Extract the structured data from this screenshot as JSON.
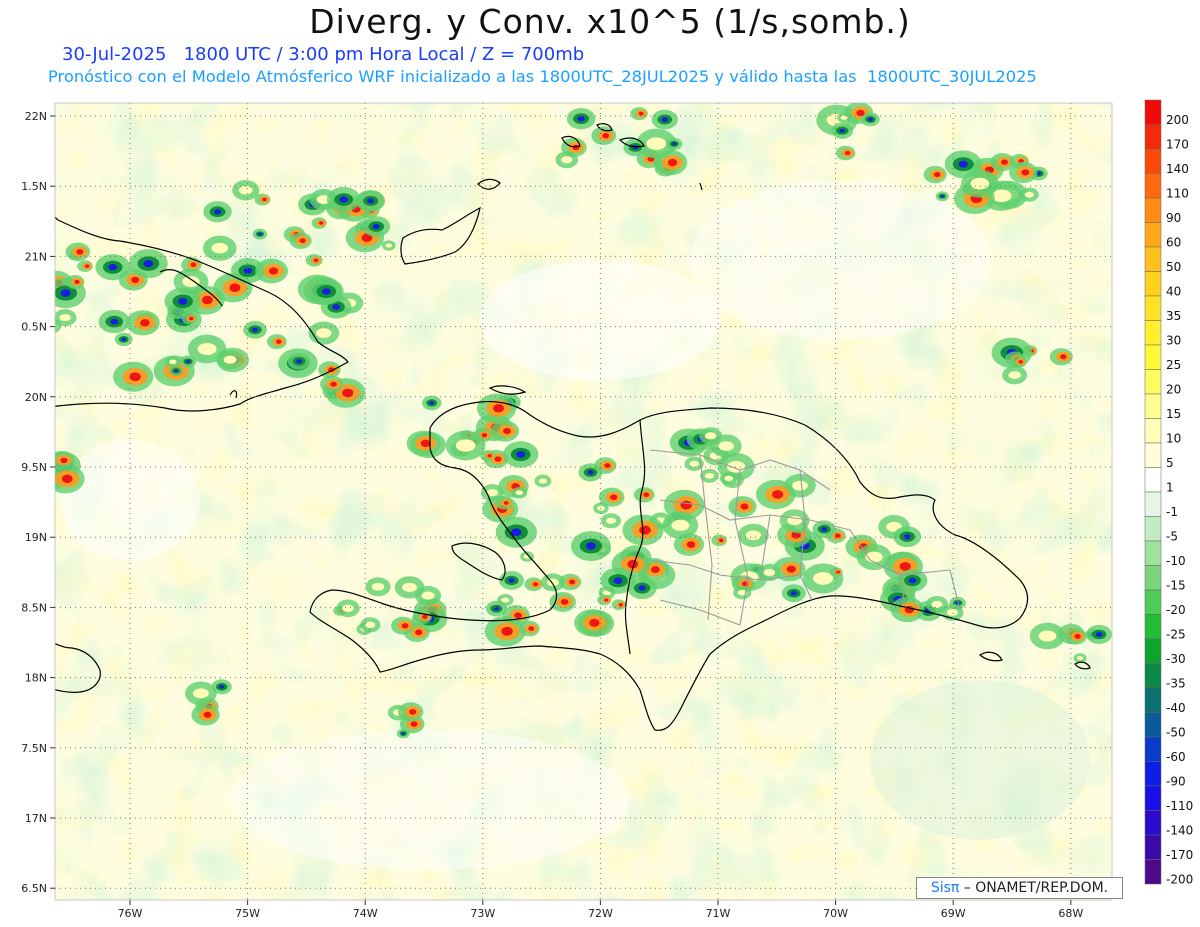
{
  "header": {
    "title": "Diverg. y Conv. x10^5 (1/s,somb.)",
    "subtitle_date": "30-Jul-2025   1800 UTC / 3:00 pm Hora Local / Z = 700mb",
    "subtitle_model": "Pronóstico con el Modelo Atmósferico WRF inicializado a las 1800UTC_28JUL2025 y válido hasta las  1800UTC_30JUL2025"
  },
  "map": {
    "lat_labels": [
      "22N",
      "1.5N",
      "21N",
      "0.5N",
      "20N",
      "9.5N",
      "19N",
      "8.5N",
      "18N",
      "7.5N",
      "17N",
      "6.5N"
    ],
    "lon_labels": [
      "76W",
      "75W",
      "74W",
      "73W",
      "72W",
      "71W",
      "70W",
      "69W",
      "68W"
    ],
    "lat_values": [
      22,
      21.5,
      21,
      20.5,
      20,
      19.5,
      19,
      18.5,
      18,
      17.5,
      17,
      16.5
    ],
    "lon_values": [
      -76,
      -75,
      -74,
      -73,
      -72,
      -71,
      -70,
      -69,
      -68
    ],
    "field_colors": {
      "pale_yellow": "#fffbb8",
      "light_green": "#b7ecb4",
      "mid_green": "#5fcf6e",
      "dark_green": "#0f8f3a",
      "blue": "#1a1ee0",
      "orange": "#ff9a1f",
      "red": "#f01414",
      "border_country": "#000000",
      "border_province": "#999999"
    }
  },
  "colorbar": {
    "labels": [
      "200",
      "170",
      "140",
      "110",
      "90",
      "60",
      "50",
      "40",
      "35",
      "30",
      "25",
      "20",
      "15",
      "10",
      "5",
      "1",
      "-1",
      "-5",
      "-10",
      "-15",
      "-20",
      "-25",
      "-30",
      "-35",
      "-40",
      "-50",
      "-60",
      "-90",
      "-110",
      "-140",
      "-170",
      "-200"
    ],
    "colors": [
      "#f00a0a",
      "#f52a0a",
      "#fa4a0a",
      "#ff6a10",
      "#ff8c14",
      "#ffa81a",
      "#ffc01e",
      "#ffd21e",
      "#ffe128",
      "#ffef30",
      "#fff838",
      "#fffc60",
      "#fffd90",
      "#fffeb8",
      "#fffed8",
      "#ffffff",
      "#e6f6e6",
      "#c3ecc3",
      "#9fe19f",
      "#7bd67b",
      "#4fcb5a",
      "#23be35",
      "#0ea52e",
      "#0b8a47",
      "#0b7070",
      "#0b5b9a",
      "#0a3ccc",
      "#0a1ee6",
      "#1a0fe6",
      "#2a0acc",
      "#3a0aa8",
      "#4a0a8a"
    ]
  },
  "credit": {
    "brand": "Sisπ",
    "org": " – ONAMET/REP.DOM."
  }
}
